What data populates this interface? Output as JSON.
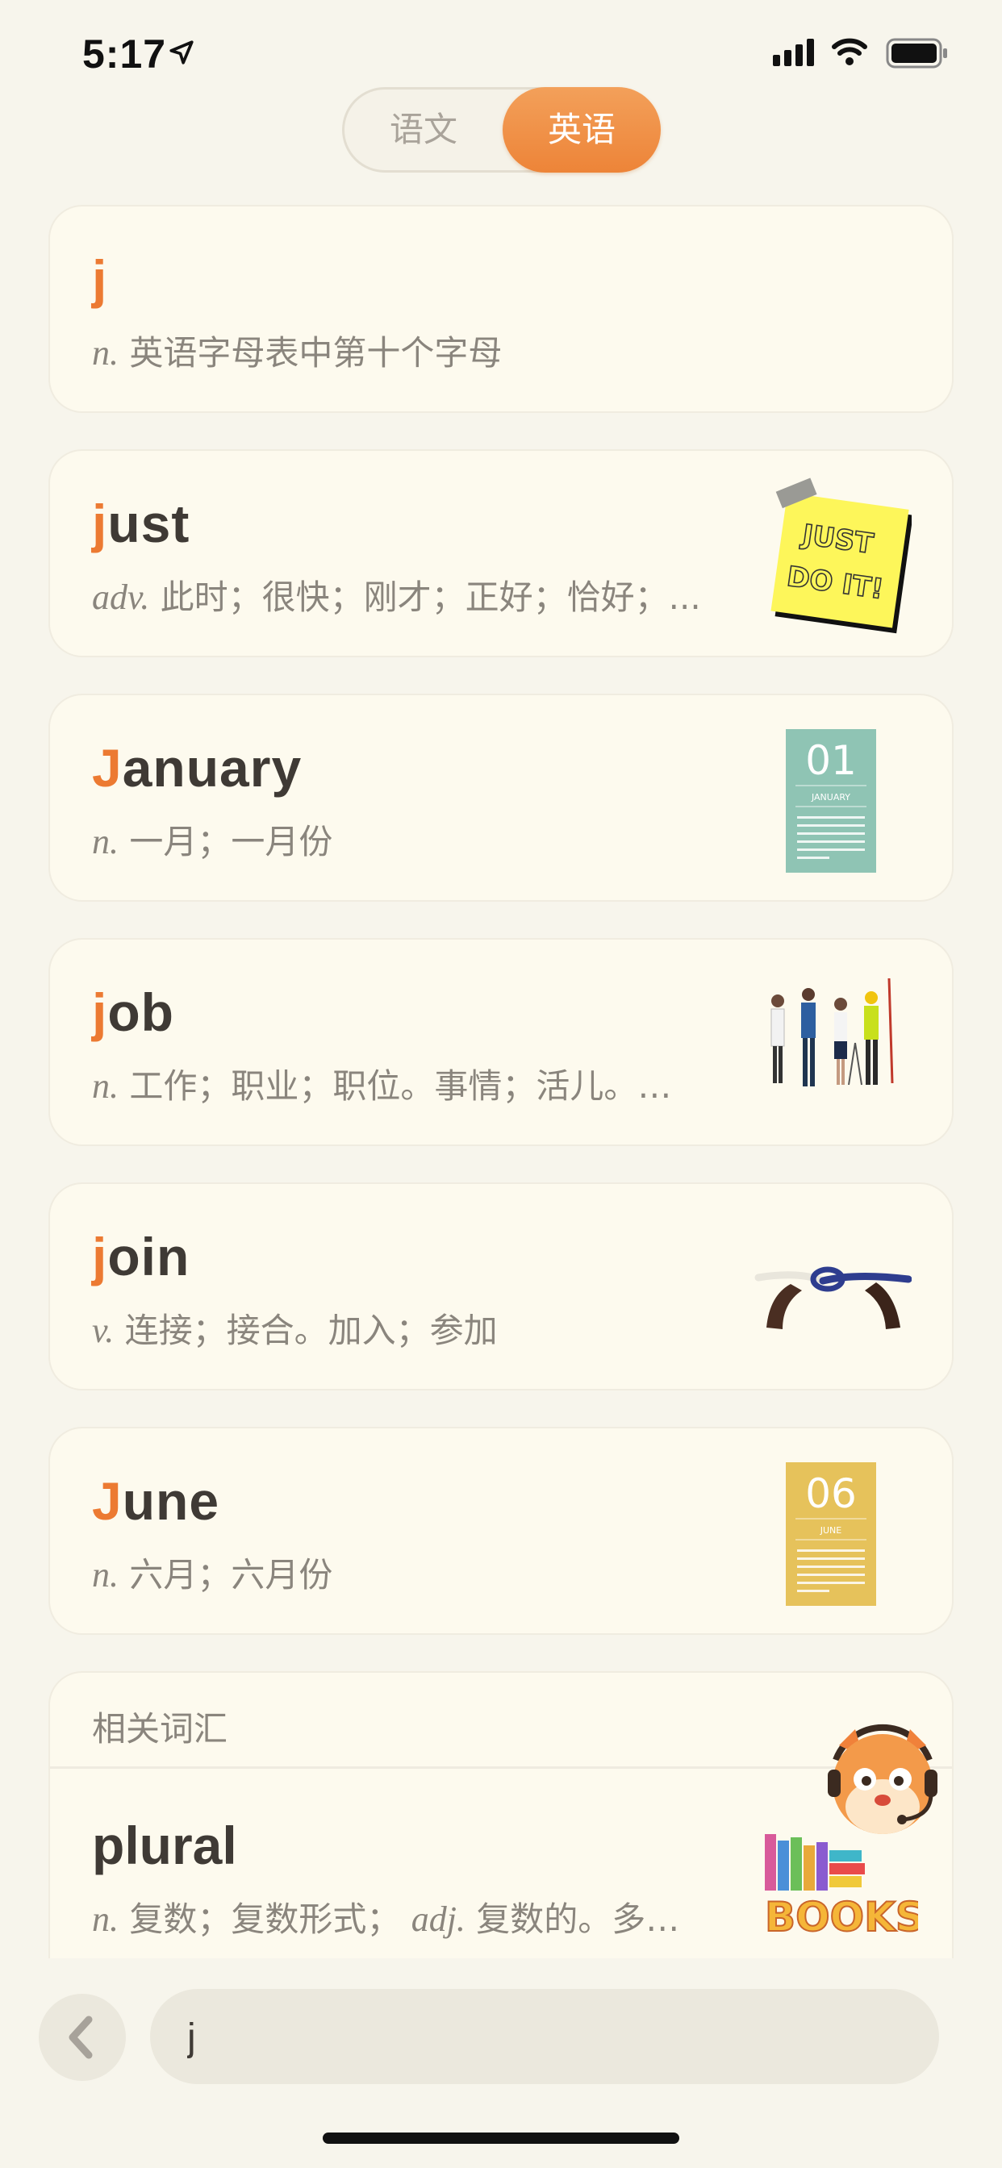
{
  "status_bar": {
    "time": "5:17"
  },
  "tabs": {
    "left": "语文",
    "right": "英语",
    "selected": "英语"
  },
  "cards": [
    {
      "prefix": "j",
      "rest": "",
      "pos": "n.",
      "def": " 英语字母表中第十个字母",
      "image": ""
    },
    {
      "prefix": "j",
      "rest": "ust",
      "pos": "adv.",
      "def": " 此时；很快；刚才；正好；恰好；...",
      "image": "just-do-it-sticky-note"
    },
    {
      "prefix": "J",
      "rest": "anuary",
      "pos": "n.",
      "def": " 一月；一月份",
      "image": "calendar-january",
      "calendar_num": "01",
      "calendar_month": "JANUARY",
      "calendar_color": "#8fc4b4"
    },
    {
      "prefix": "j",
      "rest": "ob",
      "pos": "n.",
      "def": " 工作；职业；职位。事情；活儿。…",
      "image": "workers-group"
    },
    {
      "prefix": "j",
      "rest": "oin",
      "pos": "v.",
      "def": " 连接；接合。加入；参加",
      "image": "hands-tying-rope"
    },
    {
      "prefix": "J",
      "rest": "une",
      "pos": "n.",
      "def": " 六月；六月份",
      "image": "calendar-june",
      "calendar_num": "06",
      "calendar_month": "JUNE",
      "calendar_color": "#e6c25b"
    }
  ],
  "related": {
    "header": "相关词汇",
    "word": "plural",
    "pos1": "n.",
    "def1": " 复数；复数形式； ",
    "pos2": "adj.",
    "def2": " 复数的。多…"
  },
  "search": {
    "value": "j"
  },
  "colors": {
    "accent": "#ec7a32",
    "background": "#f7f5ec",
    "card": "#fdfaee"
  }
}
